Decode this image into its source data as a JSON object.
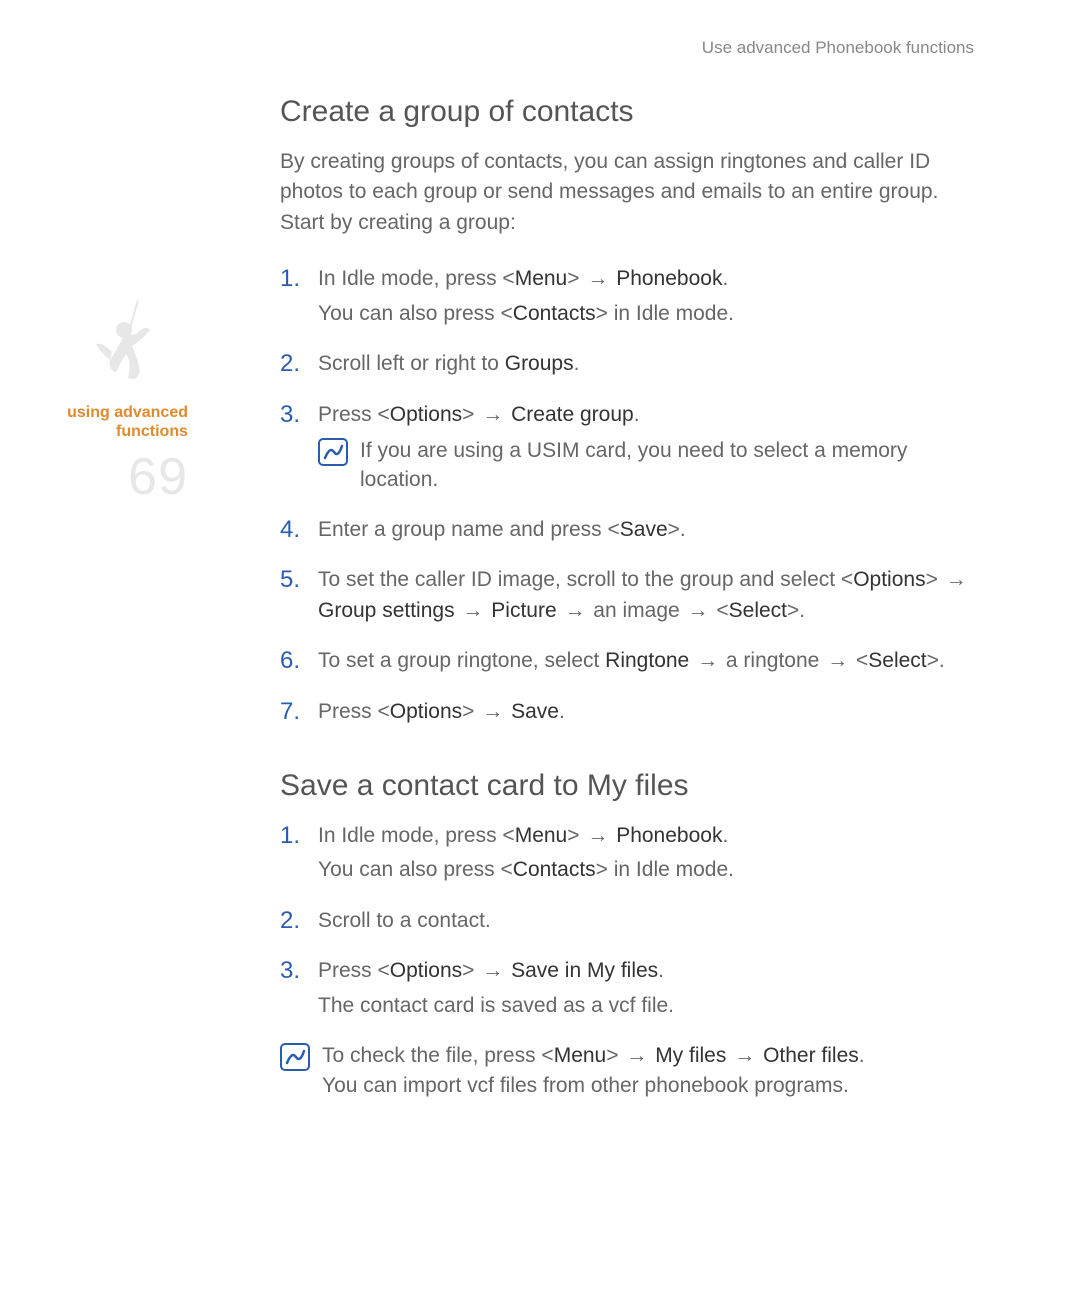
{
  "running_head": "Use advanced Phonebook functions",
  "sidebar": {
    "label_line1": "using advanced",
    "label_line2": "functions",
    "page_number": "69"
  },
  "section1": {
    "title": "Create a group of contacts",
    "intro": "By creating groups of contacts, you can assign ringtones and caller ID photos to each group or send messages and emails to an entire group. Start by creating a group:",
    "steps": [
      {
        "main_pre": "In Idle mode, press <",
        "k1": "Menu",
        "mid1": "> ",
        "arrow1": "→",
        "post1": " ",
        "k2": "Phonebook",
        "tail": ".",
        "sub_pre": "You can also press <",
        "sub_k": "Contacts",
        "sub_post": "> in Idle mode."
      },
      {
        "main_pre": "Scroll left or right to ",
        "k1": "Groups",
        "tail": "."
      },
      {
        "main_pre": "Press <",
        "k1": "Options",
        "mid1": "> ",
        "arrow1": "→",
        "post1": " ",
        "k2": "Create group",
        "tail": ".",
        "note": "If you are using a USIM card, you need to select a memory location."
      },
      {
        "main_pre": "Enter a group name and press <",
        "k1": "Save",
        "tail": ">."
      },
      {
        "long_html": true,
        "p1": "To set the caller ID image, scroll to the group and select <",
        "k1": "Options",
        "m1": "> ",
        "a1": "→",
        "s1": " ",
        "k2": "Group settings",
        "s2": " ",
        "a2": "→",
        "s3": " ",
        "k3": "Picture",
        "s4": " ",
        "a3": "→",
        "s5": " an image ",
        "a4": "→",
        "s6": " <",
        "k4": "Select",
        "tail": ">."
      },
      {
        "long_html2": true,
        "p1": "To set a group ringtone, select ",
        "k1": "Ringtone",
        "s1": " ",
        "a1": "→",
        "s2": " a ringtone ",
        "a2": "→",
        "s3": " <",
        "k2": "Select",
        "tail": ">."
      },
      {
        "main_pre": "Press <",
        "k1": "Options",
        "mid1": "> ",
        "arrow1": "→",
        "post1": " ",
        "k2": "Save",
        "tail": "."
      }
    ]
  },
  "section2": {
    "title": "Save a contact card to My files",
    "steps": [
      {
        "main_pre": "In Idle mode, press <",
        "k1": "Menu",
        "mid1": "> ",
        "arrow1": "→",
        "post1": " ",
        "k2": "Phonebook",
        "tail": ".",
        "sub_pre": "You can also press <",
        "sub_k": "Contacts",
        "sub_post": "> in Idle mode."
      },
      {
        "plain": "Scroll to a contact."
      },
      {
        "main_pre": "Press <",
        "k1": "Options",
        "mid1": "> ",
        "arrow1": "→",
        "post1": " ",
        "k2": "Save in My files",
        "tail": ".",
        "sub_plain": "The contact card is saved as a vcf file."
      }
    ],
    "note": {
      "p1": "To check the file, press <",
      "k1": "Menu",
      "m1": "> ",
      "a1": "→",
      "s1": " ",
      "k2": "My files",
      "s2": " ",
      "a2": "→",
      "s3": " ",
      "k3": "Other files",
      "tail": ".",
      "line2": "You can import vcf files from other phonebook programs."
    }
  }
}
